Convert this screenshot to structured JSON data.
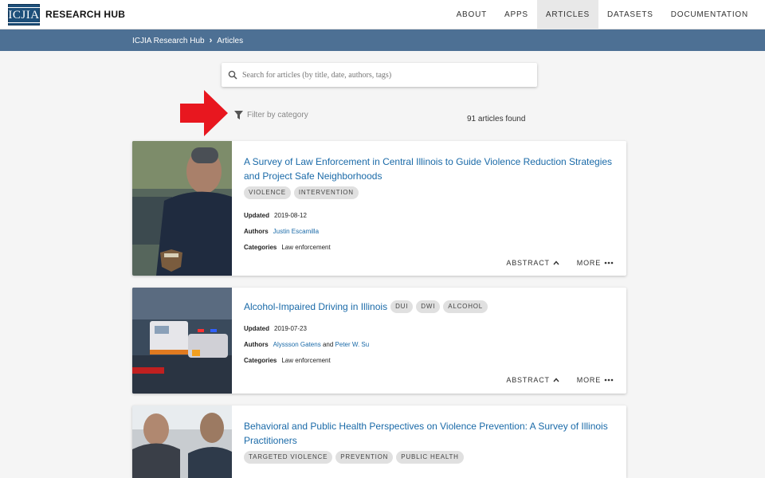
{
  "header": {
    "logo_text": "ICJIA",
    "brand": "RESEARCH HUB",
    "nav": [
      "ABOUT",
      "APPS",
      "ARTICLES",
      "DATASETS",
      "DOCUMENTATION"
    ],
    "active_nav": "ARTICLES"
  },
  "breadcrumb": {
    "home": "ICJIA Research Hub",
    "current": "Articles"
  },
  "search": {
    "placeholder": "Search for articles (by title, date, authors, tags)"
  },
  "filter": {
    "label": "Filter by category"
  },
  "results": {
    "count_text": "91 articles found"
  },
  "labels": {
    "updated": "Updated",
    "authors": "Authors",
    "categories": "Categories",
    "abstract": "ABSTRACT",
    "more": "MORE",
    "and": "and"
  },
  "articles": [
    {
      "title": "A Survey of Law Enforcement in Central Illinois to Guide Violence Reduction Strategies and Project Safe Neighborhoods",
      "tags": [
        "VIOLENCE",
        "INTERVENTION"
      ],
      "updated": "2019-08-12",
      "authors": [
        "Justin Escamilla"
      ],
      "categories": "Law enforcement"
    },
    {
      "title": "Alcohol-Impaired Driving in Illinois",
      "tags": [
        "DUI",
        "DWI",
        "ALCOHOL"
      ],
      "updated": "2019-07-23",
      "authors": [
        "Alyssson Gatens",
        "Peter W. Su"
      ],
      "categories": "Law enforcement"
    },
    {
      "title": "Behavioral and Public Health Perspectives on Violence Prevention: A Survey of Illinois Practitioners",
      "tags": [
        "TARGETED VIOLENCE",
        "PREVENTION",
        "PUBLIC HEALTH"
      ],
      "updated": "",
      "authors": [],
      "categories": ""
    }
  ],
  "colors": {
    "accent": "#1a6aa8",
    "breadcrumb_bar": "#4d7094",
    "logo": "#1d4f7a",
    "arrow": "#e8171f"
  }
}
